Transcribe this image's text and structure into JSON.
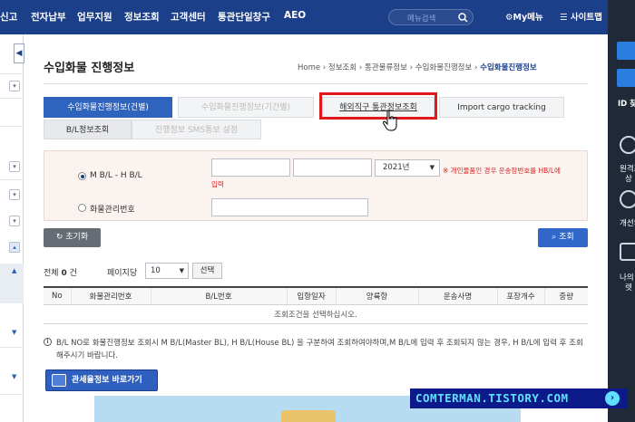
{
  "topnav": {
    "items": [
      "신고",
      "전자납부",
      "업무지원",
      "정보조회",
      "고객센터",
      "통관단일창구",
      "AEO"
    ],
    "search_placeholder": "메뉴검색",
    "my_menu": "My메뉴",
    "sitemap": "사이트맵"
  },
  "right_panel": {
    "id_text": "ID 찾",
    "item1": "원격조",
    "item1b": "상",
    "item2": "개선의",
    "item3": "나의",
    "item3b": "렛"
  },
  "page": {
    "title": "수입화물 진행정보",
    "breadcrumb": [
      "Home",
      "정보조회",
      "통관물류정보",
      "수입화물진행정보",
      "수입화물진행정보"
    ]
  },
  "tabs": {
    "main": [
      "수입화물진행정보(건별)",
      "수입화물진행정보(기간별)",
      "해외직구 통관정보조회",
      "Import cargo tracking"
    ],
    "sub": [
      "B/L정보조회",
      "진행정보 SMS통보 설정"
    ]
  },
  "search": {
    "radio_mbl": "M B/L - H B/L",
    "radio_cargo": "화물관리번호",
    "year": "2021년",
    "notice": "※ 개인물품인 경우 운송장번호를 HB/L에",
    "notice2": "입력"
  },
  "buttons": {
    "reset": "초기화",
    "query": "조회",
    "select": "선택",
    "tariff": "관세율정보 바로가기"
  },
  "results": {
    "total_label": "전체",
    "total_count": "0",
    "total_unit": "건",
    "per_page_label": "페이지당",
    "per_page_value": "10",
    "columns": [
      "No",
      "화물관리번호",
      "B/L번호",
      "입항일자",
      "양륙항",
      "운송사명",
      "포장개수",
      "중량"
    ],
    "empty_message": "조회조건을 선택하십시오."
  },
  "info": {
    "text": "B/L NO로 화물진행정보 조회시 M B/L(Master BL), H B/L(House BL) 을 구분하여 조회하여야하며,M B/L에 입력 후 조회되지 않는 경우, H B/L에 입력 후 조회해주시기 바랍니다."
  },
  "watermark": "COMTERMAN.TISTORY.COM",
  "colors": {
    "nav": "#1c3f8a",
    "accent": "#3067c9",
    "highlight": "#e01a1a"
  }
}
